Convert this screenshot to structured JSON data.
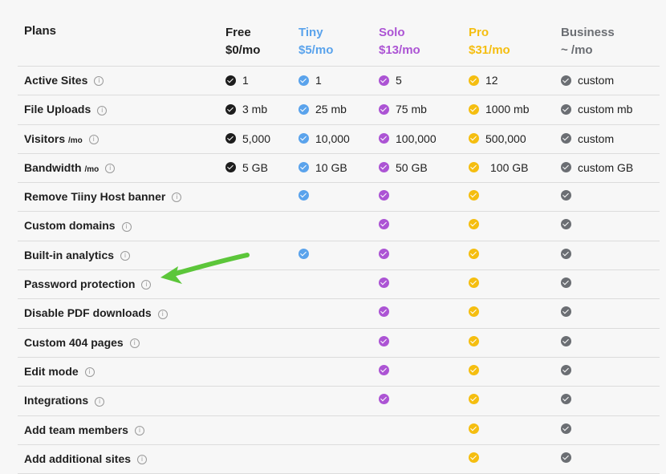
{
  "header": {
    "plans_label": "Plans",
    "plans": [
      {
        "name": "Free",
        "price": "$0/mo",
        "color": "#1d1d1d"
      },
      {
        "name": "Tiny",
        "price": "$5/mo",
        "color": "#5aa3ec"
      },
      {
        "name": "Solo",
        "price": "$13/mo",
        "color": "#ac54d4"
      },
      {
        "name": "Pro",
        "price": "$31/mo",
        "color": "#f5be10"
      },
      {
        "name": "Business",
        "price": "~ /mo",
        "color": "#6b6e73"
      }
    ]
  },
  "info_icon": "i",
  "rows": [
    {
      "label": "Active Sites",
      "suffix": "",
      "values": [
        "1",
        "1",
        "5",
        "12",
        "custom"
      ],
      "checks": [
        true,
        true,
        true,
        true,
        true
      ]
    },
    {
      "label": "File Uploads",
      "suffix": "",
      "values": [
        "3 mb",
        "25 mb",
        "75 mb",
        "1000 mb",
        "custom mb"
      ],
      "checks": [
        true,
        true,
        true,
        true,
        true
      ]
    },
    {
      "label": "Visitors",
      "suffix": "/mo",
      "values": [
        "5,000",
        "10,000",
        "100,000",
        "500,000",
        "custom"
      ],
      "checks": [
        true,
        true,
        true,
        true,
        true
      ]
    },
    {
      "label": "Bandwidth",
      "suffix": "/mo",
      "values": [
        "5 GB",
        "10 GB",
        "50 GB",
        "100 GB",
        "custom GB"
      ],
      "checks": [
        true,
        true,
        true,
        true,
        true
      ]
    },
    {
      "label": "Remove Tiiny Host banner",
      "suffix": "",
      "values": [
        "",
        "",
        "",
        "",
        ""
      ],
      "checks": [
        false,
        true,
        true,
        true,
        true
      ]
    },
    {
      "label": "Custom domains",
      "suffix": "",
      "values": [
        "",
        "",
        "",
        "",
        ""
      ],
      "checks": [
        false,
        false,
        true,
        true,
        true
      ]
    },
    {
      "label": "Built-in analytics",
      "suffix": "",
      "values": [
        "",
        "",
        "",
        "",
        ""
      ],
      "checks": [
        false,
        true,
        true,
        true,
        true
      ]
    },
    {
      "label": "Password protection",
      "suffix": "",
      "values": [
        "",
        "",
        "",
        "",
        ""
      ],
      "checks": [
        false,
        false,
        true,
        true,
        true
      ]
    },
    {
      "label": "Disable PDF downloads",
      "suffix": "",
      "values": [
        "",
        "",
        "",
        "",
        ""
      ],
      "checks": [
        false,
        false,
        true,
        true,
        true
      ]
    },
    {
      "label": "Custom 404 pages",
      "suffix": "",
      "values": [
        "",
        "",
        "",
        "",
        ""
      ],
      "checks": [
        false,
        false,
        true,
        true,
        true
      ]
    },
    {
      "label": "Edit mode",
      "suffix": "",
      "values": [
        "",
        "",
        "",
        "",
        ""
      ],
      "checks": [
        false,
        false,
        true,
        true,
        true
      ]
    },
    {
      "label": "Integrations",
      "suffix": "",
      "values": [
        "",
        "",
        "",
        "",
        ""
      ],
      "checks": [
        false,
        false,
        true,
        true,
        true
      ]
    },
    {
      "label": "Add team members",
      "suffix": "",
      "values": [
        "",
        "",
        "",
        "",
        ""
      ],
      "checks": [
        false,
        false,
        false,
        true,
        true
      ]
    },
    {
      "label": "Add additional sites",
      "suffix": "",
      "values": [
        "",
        "",
        "",
        "",
        ""
      ],
      "checks": [
        false,
        false,
        false,
        true,
        true
      ]
    }
  ],
  "annotation": {
    "arrow_color": "#5cc63a",
    "arrow_icon": "green-arrow-icon"
  }
}
